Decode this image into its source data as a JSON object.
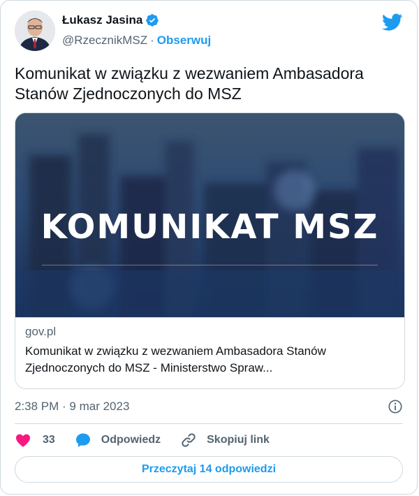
{
  "author": {
    "name": "Łukasz Jasina",
    "handle": "@RzecznikMSZ",
    "separator": "·",
    "follow_label": "Obserwuj"
  },
  "tweet": {
    "text": "Komunikat w związku z wezwaniem Ambasadora Stanów Zjednoczonych do MSZ"
  },
  "link_card": {
    "image_title": "KOMUNIKAT MSZ",
    "domain": "gov.pl",
    "title": "Komunikat w związku z wezwaniem Ambasadora Stanów Zjednoczonych do MSZ - Ministerstwo Spraw..."
  },
  "meta": {
    "timestamp": "2:38 PM · 9 mar 2023"
  },
  "actions": {
    "like_count": "33",
    "reply_label": "Odpowiedz",
    "copy_link_label": "Skopiuj link"
  },
  "footer": {
    "read_replies_label": "Przeczytaj 14 odpowiedzi"
  },
  "colors": {
    "accent": "#1d9bf0",
    "like": "#f91880",
    "text_primary": "#0f1419",
    "text_secondary": "#536471",
    "border": "#cfd9de"
  },
  "icons": {
    "verified": "verified-badge-icon",
    "logo": "twitter-bird-icon",
    "info": "info-icon",
    "like": "heart-icon",
    "reply": "speech-bubble-icon",
    "copy_link": "link-icon"
  }
}
